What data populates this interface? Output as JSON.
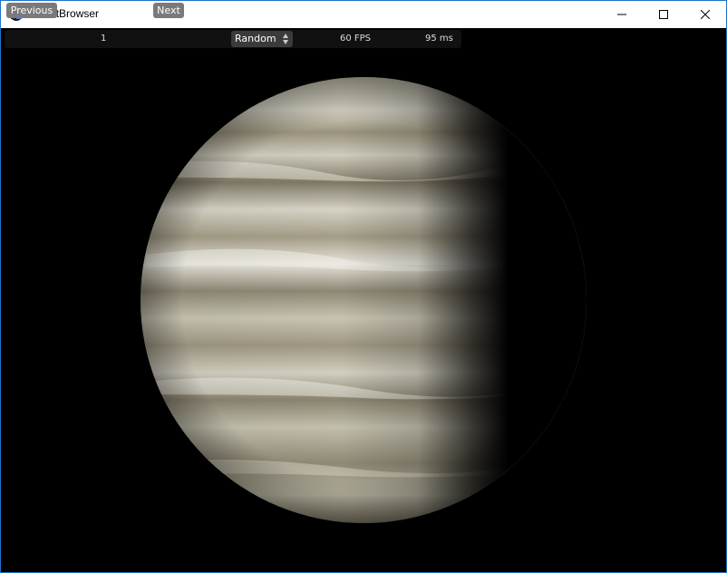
{
  "window": {
    "title": "PlanetBrowser"
  },
  "toolbar": {
    "previous_label": "Previous",
    "counter": "1",
    "next_label": "Next",
    "mode_select": "Random",
    "fps": "60 FPS",
    "frame_time": "95 ms"
  },
  "colors": {
    "accent_border": "#1e73c9",
    "button_bg": "#7a7a7a",
    "select_bg": "#3b3b3b",
    "planet_light": "#e8e6dc",
    "planet_band": "#8a8470"
  },
  "icons": {
    "app": "planet-app-icon",
    "minimize": "minimize-icon",
    "maximize": "maximize-icon",
    "close": "close-icon"
  }
}
